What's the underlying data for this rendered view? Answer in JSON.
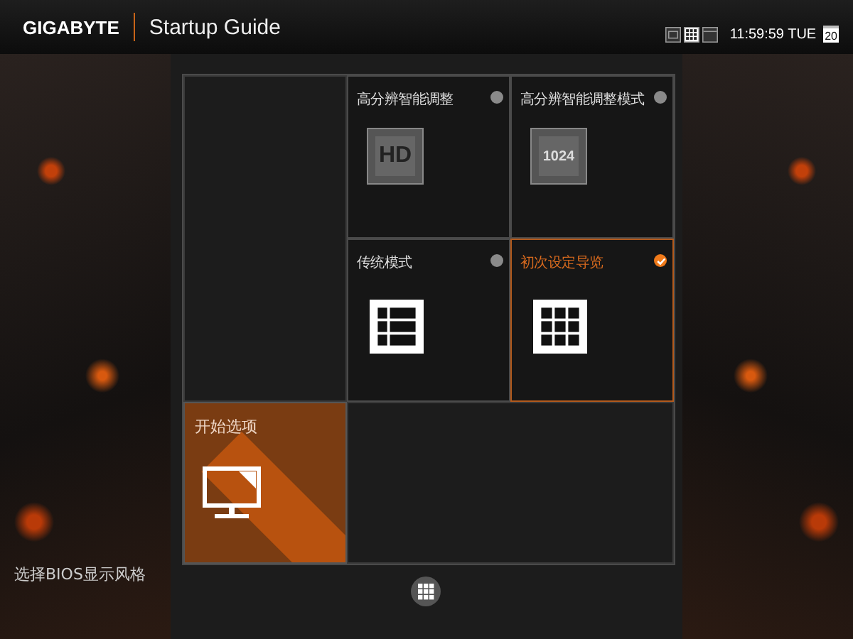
{
  "header": {
    "brand": "GIGABYTE",
    "title": "Startup Guide",
    "view_modes": [
      {
        "kind": "hd",
        "selected": false
      },
      {
        "kind": "grid",
        "selected": true
      },
      {
        "kind": "single",
        "selected": false
      }
    ],
    "time": "11:59:59 TUE",
    "date": "20"
  },
  "tiles": [
    {
      "label": "高分辨智能调整",
      "kind": "hd",
      "selected": false,
      "icon_text": "HD"
    },
    {
      "label": "高分辨智能调整模式",
      "kind": "res",
      "selected": false,
      "icon_text": "1024"
    },
    {
      "label": "传统模式",
      "kind": "list",
      "selected": false
    },
    {
      "label": "初次设定导览",
      "kind": "grid",
      "selected": true
    }
  ],
  "start_tile": {
    "label": "开始选项"
  },
  "footer": {
    "hint": "选择BIOS显示风格"
  }
}
